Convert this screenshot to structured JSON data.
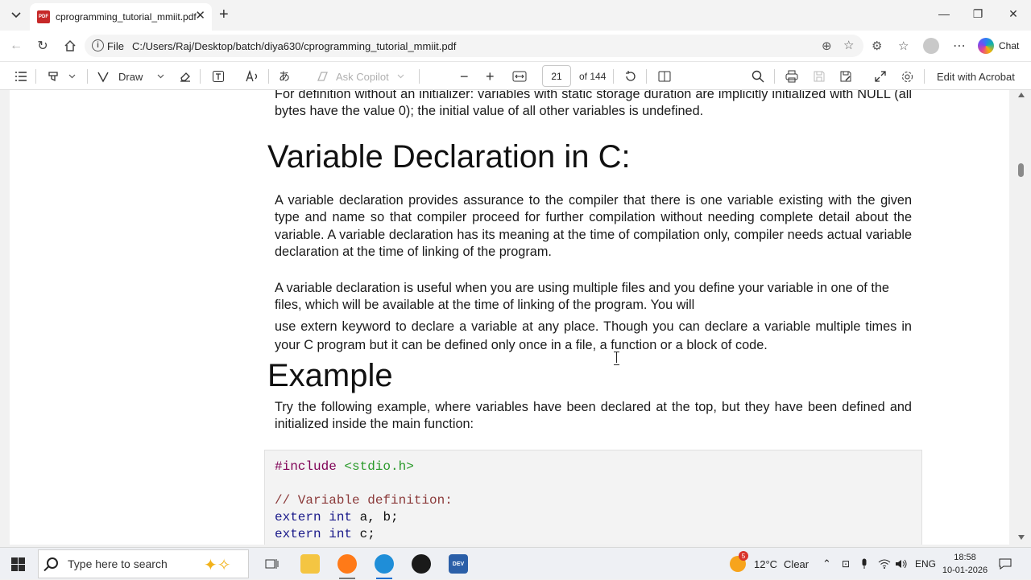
{
  "browser": {
    "tab_title": "cprogramming_tutorial_mmiit.pdf",
    "url_label": "File",
    "url": "C:/Users/Raj/Desktop/batch/diya630/cprogramming_tutorial_mmiit.pdf",
    "chat_label": "Chat"
  },
  "pdf_toolbar": {
    "draw_label": "Draw",
    "ask_copilot_label": "Ask Copilot",
    "page_number": "21",
    "page_total": "of 144",
    "edit_label": "Edit with Acrobat"
  },
  "document": {
    "para_top": "For definition without an initializer: variables with static storage duration are implicitly initialized with NULL (all bytes have the value 0); the initial value of all other variables is undefined.",
    "heading1": "Variable Declaration in C:",
    "para1": "A variable declaration provides assurance to the compiler that there is one variable existing with the given type and name so that compiler proceed for further compilation without needing complete detail about the variable. A variable declaration has its meaning at the time of compilation only, compiler needs actual variable declaration at the time of linking of the program.",
    "para2a": "A variable declaration is useful when you are using multiple files and you define your variable in one of the files, which will be available at the time of linking of the program. You will",
    "para2b": "use extern keyword to declare a variable at any place. Though you can declare a variable multiple times in your C program but it can be defined only once in a file, a function or a block of code.",
    "heading2": "Example",
    "para3": "Try the following example, where variables have been declared at the top, but they have been defined and initialized inside the main function:",
    "code": {
      "line1_directive": "#include",
      "line1_header": "<stdio.h>",
      "line2_comment": "// Variable definition:",
      "line3_kw": "extern",
      "line3_type": "int",
      "line3_rest": "a, b;",
      "line4_kw": "extern",
      "line4_type": "int",
      "line4_rest": "c;"
    }
  },
  "taskbar": {
    "search_placeholder": "Type here to search",
    "weather_badge": "5",
    "temperature": "12°C",
    "condition": "Clear",
    "language": "ENG",
    "time": "18:58",
    "date": "10-01-2026"
  },
  "colors": {
    "pdf_red": "#c62828",
    "code_bg": "#f3f3f3",
    "code_directive": "#7f0055",
    "code_string": "#2a9a2a",
    "code_comment": "#8b3a3a",
    "code_keyword": "#1a1a8a"
  }
}
